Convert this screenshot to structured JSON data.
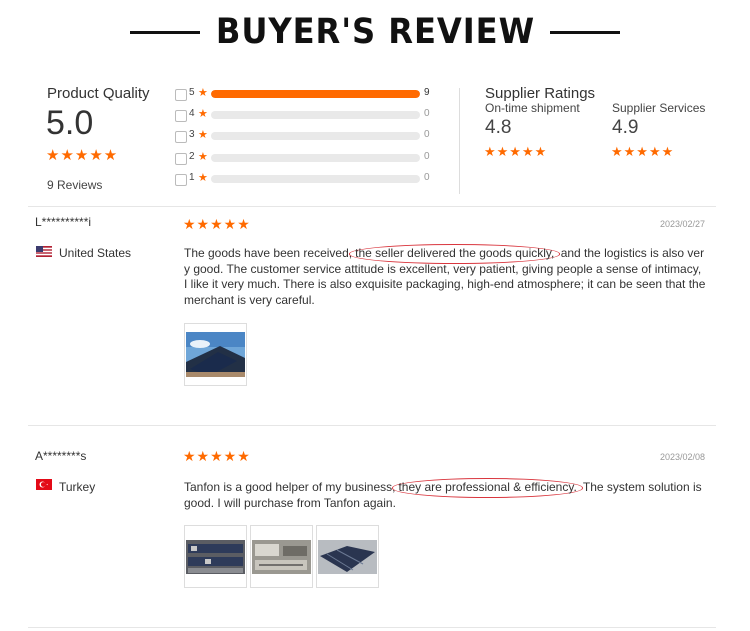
{
  "banner": {
    "title": "BUYER'S REVIEW"
  },
  "product_quality": {
    "label": "Product Quality",
    "score": "5.0",
    "stars": "★★★★★",
    "reviews_count": "9 Reviews",
    "rows": [
      {
        "label": "5",
        "count": "9",
        "fill_fraction": 1.0
      },
      {
        "label": "4",
        "count": "0",
        "fill_fraction": 0
      },
      {
        "label": "3",
        "count": "0",
        "fill_fraction": 0
      },
      {
        "label": "2",
        "count": "0",
        "fill_fraction": 0
      },
      {
        "label": "1",
        "count": "0",
        "fill_fraction": 0
      }
    ],
    "star_glyph": "★"
  },
  "supplier_ratings": {
    "title": "Supplier Ratings",
    "items": [
      {
        "label": "On-time shipment",
        "value": "4.8",
        "stars": "★★★★★"
      },
      {
        "label": "Supplier Services",
        "value": "4.9",
        "stars": "★★★★★"
      }
    ]
  },
  "reviews": [
    {
      "name": "L**********i",
      "country": "United States",
      "flag": "us-flag-icon",
      "stars": "★★★★★",
      "date": "2023/02/27",
      "text_before": "The goods have been received,",
      "text_highlight": "the seller delivered the goods quickly,",
      "text_after": " and the logistics is also very good. The customer service attitude is excellent, very patient, giving people a sense of intimacy, I like it very much. There is also exquisite packaging, high-end atmosphere; it can be seen that the merchant is very careful.",
      "photos": [
        "rooftop-solar-photo"
      ]
    },
    {
      "name": "A********s",
      "country": "Turkey",
      "flag": "turkey-flag-icon",
      "stars": "★★★★★",
      "date": "2023/02/08",
      "text_before": "Tanfon is a good helper of my business,",
      "text_highlight": " they are professional & efficiency.",
      "text_after": " The system solution is good. I will purchase from Tanfon again.",
      "photos": [
        "battery-rack-photo",
        "inverter-install-photo",
        "solar-panels-photo"
      ]
    }
  ],
  "colors": {
    "accent": "#ff6a00",
    "highlight_circle": "#d9363e",
    "track": "#e9e9e9"
  }
}
